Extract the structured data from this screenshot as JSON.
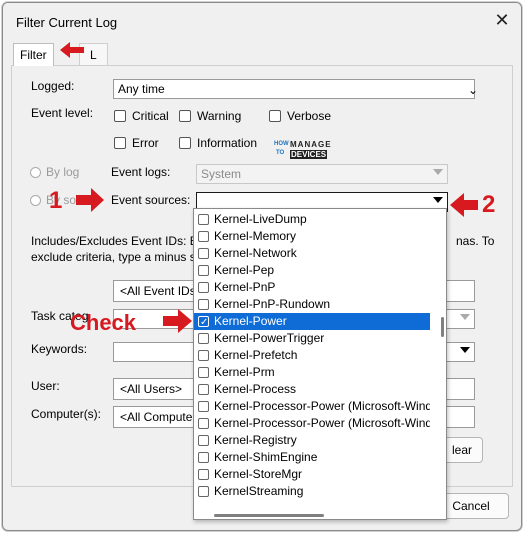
{
  "window": {
    "title": "Filter Current Log",
    "close_glyph": "✕"
  },
  "tabs": [
    {
      "label": "Filter"
    },
    {
      "label": "L"
    }
  ],
  "logged": {
    "label": "Logged:",
    "value": "Any time"
  },
  "event_level": {
    "label": "Event level:",
    "options": [
      "Critical",
      "Warning",
      "Verbose",
      "Error",
      "Information"
    ]
  },
  "by_log": {
    "label": "By log",
    "event_logs_label": "Event logs:",
    "event_logs_value": "System"
  },
  "by_source": {
    "label": "By sou",
    "event_sources_label": "Event sources:",
    "event_sources_value": ""
  },
  "event_ids": {
    "description_line1": "Includes/Excludes Event IDs: Ente",
    "description_line1_tail": "nas. To",
    "description_line2": "exclude criteria, type a minus sign",
    "value": "<All Event IDs>"
  },
  "task_category": {
    "label": "Task categ"
  },
  "keywords": {
    "label": "Keywords:"
  },
  "user": {
    "label": "User:",
    "value": "<All Users>"
  },
  "computers": {
    "label": "Computer(s):",
    "value": "<All Computers"
  },
  "buttons": {
    "clear": "lear",
    "cancel": "Cancel"
  },
  "sources_list": [
    {
      "label": "Kernel-LiveDump",
      "checked": false
    },
    {
      "label": "Kernel-Memory",
      "checked": false
    },
    {
      "label": "Kernel-Network",
      "checked": false
    },
    {
      "label": "Kernel-Pep",
      "checked": false
    },
    {
      "label": "Kernel-PnP",
      "checked": false
    },
    {
      "label": "Kernel-PnP-Rundown",
      "checked": false
    },
    {
      "label": "Kernel-Power",
      "checked": true
    },
    {
      "label": "Kernel-PowerTrigger",
      "checked": false
    },
    {
      "label": "Kernel-Prefetch",
      "checked": false
    },
    {
      "label": "Kernel-Prm",
      "checked": false
    },
    {
      "label": "Kernel-Process",
      "checked": false
    },
    {
      "label": "Kernel-Processor-Power (Microsoft-Window",
      "checked": false
    },
    {
      "label": "Kernel-Processor-Power (Microsoft-Window",
      "checked": false
    },
    {
      "label": "Kernel-Registry",
      "checked": false
    },
    {
      "label": "Kernel-ShimEngine",
      "checked": false
    },
    {
      "label": "Kernel-StoreMgr",
      "checked": false
    },
    {
      "label": "KernelStreaming",
      "checked": false
    }
  ],
  "annotations": {
    "step1": "1",
    "step2": "2",
    "check": "Check"
  },
  "logo": {
    "how": "HOW",
    "to": "TO",
    "manage": "MANAGE",
    "devices": "DEVICES"
  },
  "colors": {
    "accent_red": "#d71920",
    "selection_blue": "#0f6cd6"
  }
}
